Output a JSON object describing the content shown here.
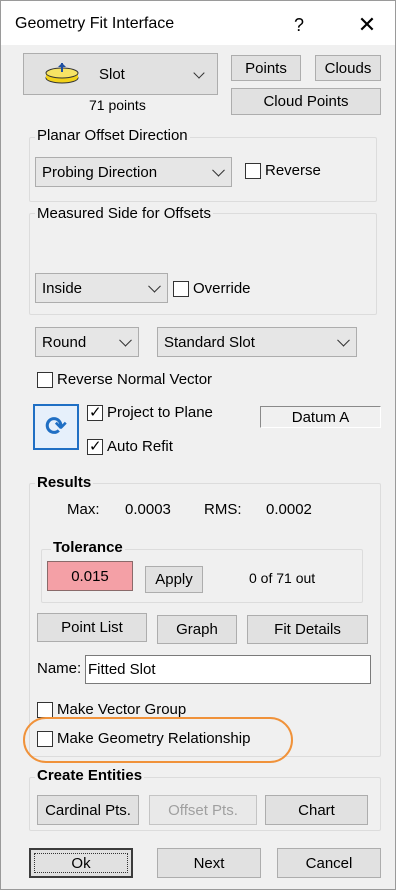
{
  "window": {
    "title": "Geometry Fit Interface",
    "help": "?",
    "close": "✕"
  },
  "feature": {
    "type_label": "Slot",
    "point_count": "71 points",
    "icon": "slot-icon"
  },
  "source_buttons": {
    "points": "Points",
    "clouds": "Clouds",
    "cloud_points": "Cloud Points"
  },
  "planar_offset": {
    "group_label": "Planar Offset Direction",
    "direction": "Probing Direction",
    "reverse_label": "Reverse",
    "reverse_checked": false
  },
  "measured_side": {
    "group_label": "Measured Side for Offsets",
    "side": "Inside",
    "override_label": "Override",
    "override_checked": false
  },
  "fit_options": {
    "shape": "Round",
    "slot_type": "Standard Slot",
    "reverse_normal_label": "Reverse Normal Vector",
    "reverse_normal_checked": false,
    "project_to_plane_label": "Project to Plane",
    "project_to_plane_checked": true,
    "auto_refit_label": "Auto Refit",
    "auto_refit_checked": true,
    "datum": "Datum A",
    "refit_icon": "refresh-icon"
  },
  "results": {
    "group_label": "Results",
    "max_label": "Max:",
    "max_value": "0.0003",
    "rms_label": "RMS:",
    "rms_value": "0.0002",
    "tolerance_label": "Tolerance",
    "tolerance_value": "0.015",
    "apply_label": "Apply",
    "out_count": "0 of 71 out",
    "point_list_label": "Point List",
    "graph_label": "Graph",
    "fit_details_label": "Fit Details",
    "name_label": "Name:",
    "name_value": "Fitted Slot",
    "make_vector_group_label": "Make Vector Group",
    "make_vector_group_checked": false,
    "make_geometry_relationship_label": "Make Geometry Relationship",
    "make_geometry_relationship_checked": false
  },
  "create_entities": {
    "group_label": "Create Entities",
    "cardinal_label": "Cardinal Pts.",
    "offset_label": "Offset Pts.",
    "chart_label": "Chart"
  },
  "footer": {
    "ok": "Ok",
    "next": "Next",
    "cancel": "Cancel"
  },
  "colors": {
    "tolerance_bg": "#f4a0a6",
    "highlight": "#f0923a",
    "refit_icon": "#1f6fc4"
  }
}
